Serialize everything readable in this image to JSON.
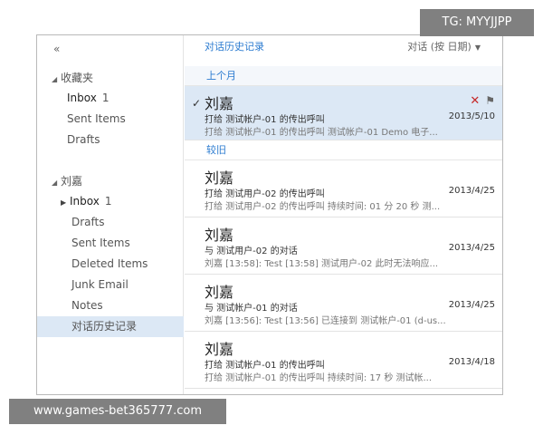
{
  "sidebar": {
    "collapse_glyph": "«",
    "favorites": {
      "title": "收藏夹",
      "items": [
        {
          "label": "Inbox",
          "count": "1"
        },
        {
          "label": "Sent Items",
          "count": ""
        },
        {
          "label": "Drafts",
          "count": ""
        }
      ]
    },
    "account": {
      "title": "刘嘉",
      "items": [
        {
          "label": "Inbox",
          "count": "1"
        },
        {
          "label": "Drafts",
          "count": ""
        },
        {
          "label": "Sent Items",
          "count": ""
        },
        {
          "label": "Deleted Items",
          "count": ""
        },
        {
          "label": "Junk Email",
          "count": ""
        },
        {
          "label": "Notes",
          "count": ""
        },
        {
          "label": "对话历史记录",
          "count": ""
        }
      ]
    }
  },
  "pane": {
    "title": "对话历史记录",
    "sort_label": "对话 (按 日期)",
    "sections": {
      "last_month": "上个月",
      "older": "较旧"
    }
  },
  "messages": [
    {
      "sender": "刘嘉",
      "subject": "打给 测试帐户-01 的传出呼叫",
      "date": "2013/5/10",
      "preview": "打给 测试帐户-01 的传出呼叫 测试帐户-01 Demo 电子..."
    },
    {
      "sender": "刘嘉",
      "subject": "打给 测试用户-02 的传出呼叫",
      "date": "2013/4/25",
      "preview": "打给 测试用户-02 的传出呼叫 持续时间: 01 分 20 秒 测..."
    },
    {
      "sender": "刘嘉",
      "subject": "与 测试用户-02 的对话",
      "date": "2013/4/25",
      "preview": "刘嘉 [13:58]: Test [13:58] 测试用户-02 此时无法响应..."
    },
    {
      "sender": "刘嘉",
      "subject": "与 测试帐户-01 的对话",
      "date": "2013/4/25",
      "preview": "刘嘉 [13:56]: Test [13:56] 已连接到 测试帐户-01 (d-us..."
    },
    {
      "sender": "刘嘉",
      "subject": "打给 测试帐户-01 的传出呼叫",
      "date": "2013/4/18",
      "preview": "打给 测试帐户-01 的传出呼叫 持续时间: 17 秒 测试帐..."
    }
  ],
  "overlays": {
    "tg_badge": "TG: MYYJJPP",
    "watermark": "www.games-bet365777.com"
  },
  "colors": {
    "accent": "#2b7bd0",
    "selected_bg": "#dce8f5",
    "delete": "#c62828"
  }
}
